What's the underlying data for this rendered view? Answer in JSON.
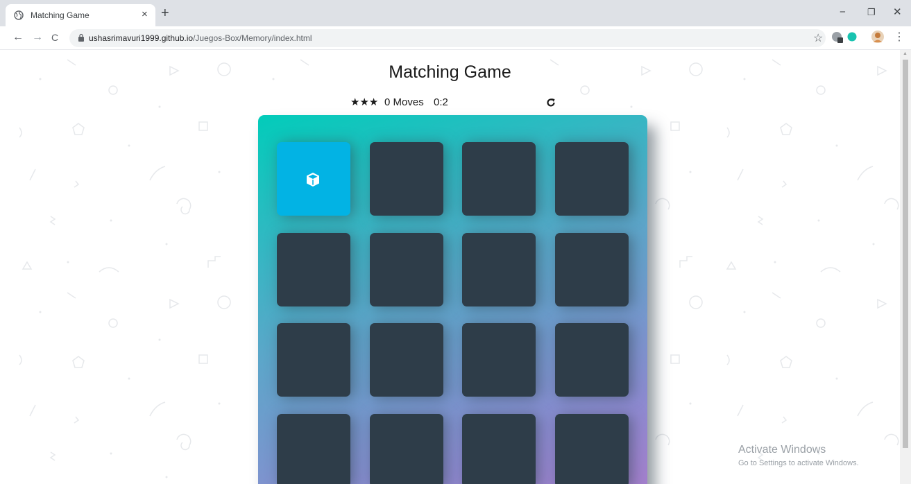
{
  "browser": {
    "tab_title": "Matching Game",
    "tab_close": "×",
    "new_tab": "+",
    "url_host": "ushasrimavuri1999.github.io",
    "url_path": "/Juegos-Box/Memory/index.html",
    "controls": {
      "minimize": "−",
      "restore": "❐",
      "close": "✕"
    },
    "nav": {
      "back": "←",
      "forward": "→",
      "reload": "C"
    },
    "bookmark_star": "☆",
    "menu": "⋮"
  },
  "game": {
    "title": "Matching Game",
    "stars": "★★★",
    "moves": "0 Moves",
    "timer": "0:2",
    "restart_icon": "refresh-icon",
    "cards": [
      {
        "state": "open",
        "icon": "cube-icon"
      },
      {
        "state": "closed"
      },
      {
        "state": "closed"
      },
      {
        "state": "closed"
      },
      {
        "state": "closed"
      },
      {
        "state": "closed"
      },
      {
        "state": "closed"
      },
      {
        "state": "closed"
      },
      {
        "state": "closed"
      },
      {
        "state": "closed"
      },
      {
        "state": "closed"
      },
      {
        "state": "closed"
      },
      {
        "state": "closed"
      },
      {
        "state": "closed"
      },
      {
        "state": "closed"
      },
      {
        "state": "closed"
      }
    ],
    "colors": {
      "card_closed": "#2e3d49",
      "card_open": "#02b3e4",
      "deck_start": "#02ccba",
      "deck_end": "#aa7ecd"
    }
  },
  "watermark": {
    "title": "Activate Windows",
    "subtitle": "Go to Settings to activate Windows."
  }
}
